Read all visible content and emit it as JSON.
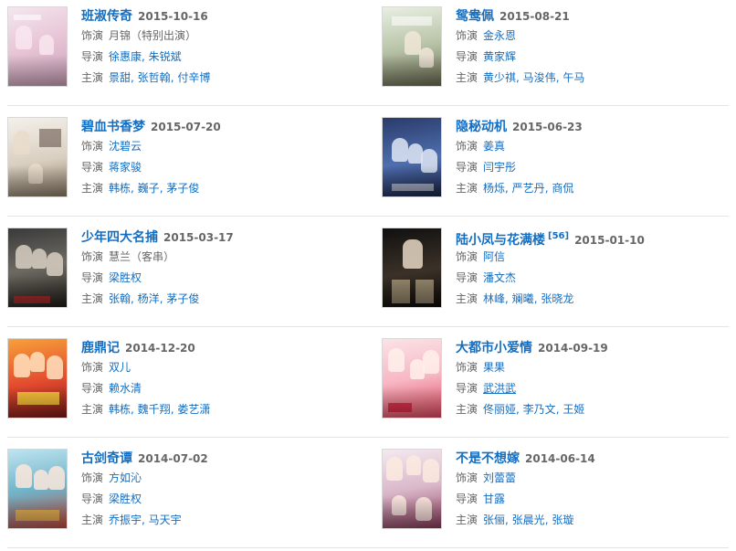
{
  "labels": {
    "role": "饰演",
    "director": "导演",
    "cast": "主演"
  },
  "items": [
    {
      "title": "班淑传奇",
      "sup": "",
      "date": "2015-10-16",
      "role": "月锦（特别出演）",
      "directors": [
        "徐惠康",
        "朱锐斌"
      ],
      "cast": [
        "景甜",
        "张哲翰",
        "付辛博"
      ],
      "poster": {
        "bg": "linear-gradient(160deg,#f3e7ef 0%,#e9c7d8 45%,#c9a0b8 100%)",
        "fig": "#f9e6ee",
        "accent": "#b33b6a"
      }
    },
    {
      "title": "鸳鸯佩",
      "sup": "",
      "date": "2015-08-21",
      "role": "金永恩",
      "directors": [
        "黄家辉"
      ],
      "cast": [
        "黄少祺",
        "马浚伟",
        "午马"
      ],
      "poster": {
        "bg": "linear-gradient(170deg,#e9efe2 0%,#b8c4a8 50%,#6a6b50 100%)",
        "fig": "#f1e6d8",
        "accent": "#3a2a1d"
      }
    },
    {
      "title": "碧血书香梦",
      "sup": "",
      "date": "2015-07-20",
      "role": "沈碧云",
      "directors": [
        "蒋家骏"
      ],
      "cast": [
        "韩栋",
        "巍子",
        "茅子俊"
      ],
      "poster": {
        "bg": "linear-gradient(170deg,#f4f0ea 0%,#d9cfc0 55%,#8a7a66 100%)",
        "fig": "#e9dccb",
        "accent": "#5a3b2a"
      }
    },
    {
      "title": "隐秘动机",
      "sup": "",
      "date": "2015-06-23",
      "role": "姜真",
      "directors": [
        "闫宇彤"
      ],
      "cast": [
        "杨烁",
        "严艺丹",
        "商侃"
      ],
      "poster": {
        "bg": "linear-gradient(170deg,#2a3b6a 0%,#4f6fb0 55%,#1b2446 100%)",
        "fig": "#dfe6f5",
        "accent": "#0e1530"
      }
    },
    {
      "title": "少年四大名捕",
      "sup": "",
      "date": "2015-03-17",
      "role": "慧兰（客串）",
      "directors": [
        "梁胜权"
      ],
      "cast": [
        "张翰",
        "杨洋",
        "茅子俊"
      ],
      "poster": {
        "bg": "linear-gradient(170deg,#3a3a3a 0%,#6d6a62 50%,#1e1b18 100%)",
        "fig": "#d8cfc2",
        "accent": "#9a1f1f"
      }
    },
    {
      "title": "陆小凤与花满楼",
      "sup": "[56]",
      "date": "2015-01-10",
      "role": "阿信",
      "directors": [
        "潘文杰"
      ],
      "cast": [
        "林峰",
        "斓曦",
        "张晓龙"
      ],
      "poster": {
        "bg": "linear-gradient(170deg,#101010 0%,#3b3128 55%,#0c0a08 100%)",
        "fig": "#e6d7c3",
        "accent": "#c9a76b"
      }
    },
    {
      "title": "鹿鼎记",
      "sup": "",
      "date": "2014-12-20",
      "role": "双儿",
      "directors": [
        "赖水清"
      ],
      "cast": [
        "韩栋",
        "魏千翔",
        "娄艺潇"
      ],
      "poster": {
        "bg": "linear-gradient(170deg,#f6a13a 0%,#e34a2e 55%,#7a1a18 100%)",
        "fig": "#ffe2c0",
        "accent": "#f7d23a"
      }
    },
    {
      "title": "大都市小爱情",
      "sup": "",
      "date": "2014-09-19",
      "role": "果果",
      "directors": [
        "武洪武"
      ],
      "cast": [
        "佟丽娅",
        "李乃文",
        "王姬"
      ],
      "poster": {
        "bg": "linear-gradient(170deg,#fbe3e6 0%,#f7b7c4 50%,#e0485e 100%)",
        "fig": "#fff0ea",
        "accent": "#d41f3a"
      }
    },
    {
      "title": "古剑奇谭",
      "sup": "",
      "date": "2014-07-02",
      "role": "方如沁",
      "directors": [
        "梁胜权"
      ],
      "cast": [
        "乔振宇",
        "马天宇"
      ],
      "poster": {
        "bg": "linear-gradient(170deg,#bfe4ef 0%,#6fb3c9 50%,#c24a3a 100%)",
        "fig": "#fbe8da",
        "accent": "#e8b04a"
      }
    },
    {
      "title": "不是不想嫁",
      "sup": "",
      "date": "2014-06-14",
      "role": "刘蕾蕾",
      "directors": [
        "甘露"
      ],
      "cast": [
        "张俪",
        "张晨光",
        "张璇"
      ],
      "poster": {
        "bg": "linear-gradient(170deg,#f4e9f0 0%,#d9b7c9 50%,#8a3b5a 100%)",
        "fig": "#fbeadf",
        "accent": "#6b2440"
      }
    }
  ]
}
